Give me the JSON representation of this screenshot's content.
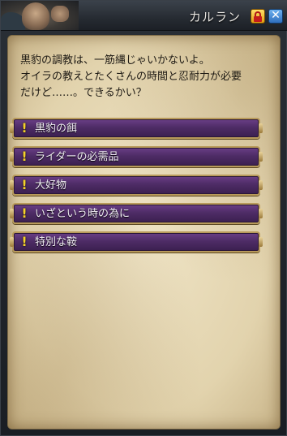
{
  "window": {
    "title": "カルラン",
    "lock_icon": "lock-icon",
    "close_glyph": "✕"
  },
  "dialogue": {
    "lines": [
      "黒豹の調教は、一筋縄じゃいかないよ。",
      "オイラの教えとたくさんの時間と忍耐力が必要",
      "だけど……。できるかい？"
    ]
  },
  "options": [
    {
      "marker": "!",
      "label": "黒豹の餌"
    },
    {
      "marker": "!",
      "label": "ライダーの必需品"
    },
    {
      "marker": "!",
      "label": "大好物"
    },
    {
      "marker": "!",
      "label": "いざという時の為に"
    },
    {
      "marker": "!",
      "label": "特別な鞍"
    }
  ],
  "colors": {
    "quest_marker": "#f4d12a",
    "option_bg": "#4e2c66",
    "parchment": "#e2d3ad"
  }
}
